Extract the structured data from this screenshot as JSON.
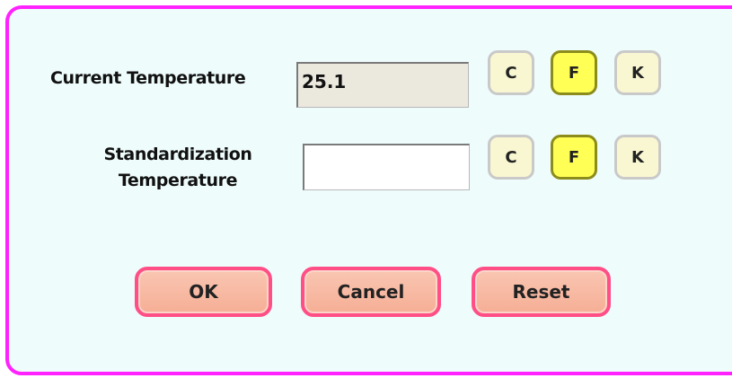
{
  "dialog": {
    "accent_color": "#ff22ff",
    "background_color": "#effcfc"
  },
  "current": {
    "label": "Current Temperature",
    "value": "25.1",
    "units": [
      "C",
      "F",
      "K"
    ],
    "selected_unit": "F"
  },
  "standardization": {
    "label_line1": "Standardization",
    "label_line2": "Temperature",
    "value": "",
    "units": [
      "C",
      "F",
      "K"
    ],
    "selected_unit": "F"
  },
  "actions": {
    "ok": "OK",
    "cancel": "Cancel",
    "reset": "Reset"
  }
}
